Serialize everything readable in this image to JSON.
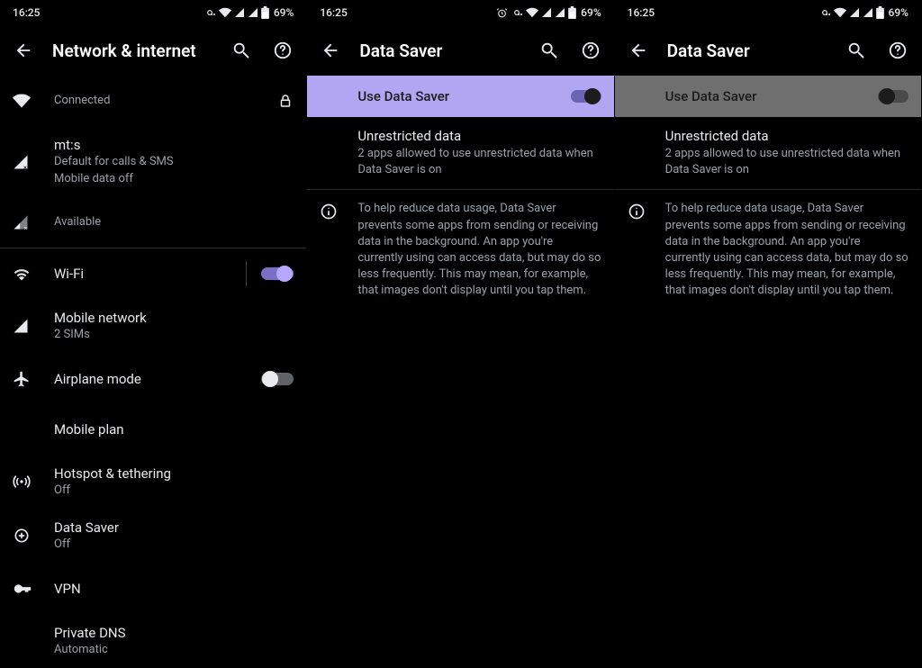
{
  "status": {
    "time": "16:25",
    "battery": "69%"
  },
  "pane1": {
    "title": "Network & internet",
    "wifi_status_row": {
      "label": "Connected"
    },
    "sim1": {
      "name": "mt:s",
      "line1": "Default for calls & SMS",
      "line2": "Mobile data off"
    },
    "sim2": {
      "label": "Available"
    },
    "wifi": {
      "label": "Wi-Fi"
    },
    "mobile_network": {
      "label": "Mobile network",
      "sub": "2 SIMs"
    },
    "airplane": {
      "label": "Airplane mode"
    },
    "mobile_plan": {
      "label": "Mobile plan"
    },
    "hotspot": {
      "label": "Hotspot & tethering",
      "sub": "Off"
    },
    "data_saver": {
      "label": "Data Saver",
      "sub": "Off"
    },
    "vpn": {
      "label": "VPN"
    },
    "private_dns": {
      "label": "Private DNS",
      "sub": "Automatic"
    }
  },
  "pane2": {
    "title": "Data Saver",
    "toggle_label": "Use Data Saver",
    "unrestricted": {
      "title": "Unrestricted data",
      "sub": "2 apps allowed to use unrestricted data when Data Saver is on"
    },
    "help": "To help reduce data usage, Data Saver prevents some apps from sending or receiving data in the background. An app you're currently using can access data, but may do so less frequently. This may mean, for example, that images don't display until you tap them."
  },
  "pane3": {
    "title": "Data Saver",
    "toggle_label": "Use Data Saver",
    "unrestricted": {
      "title": "Unrestricted data",
      "sub": "2 apps allowed to use unrestricted data when Data Saver is on"
    },
    "help": "To help reduce data usage, Data Saver prevents some apps from sending or receiving data in the background. An app you're currently using can access data, but may do so less frequently. This may mean, for example, that images don't display until you tap them."
  }
}
